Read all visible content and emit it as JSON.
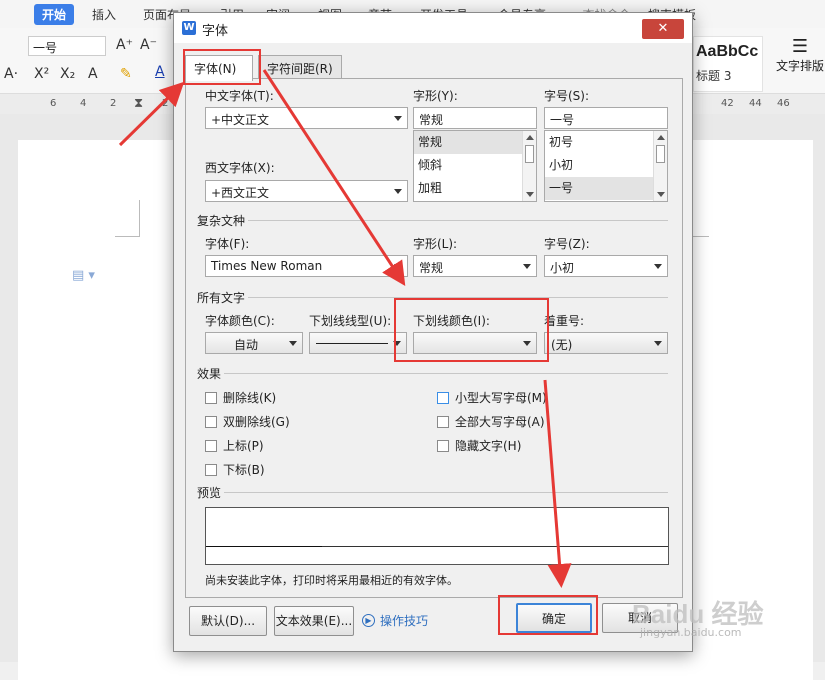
{
  "app": {
    "menu": [
      "开始",
      "插入",
      "页面布局",
      "引用",
      "审阅",
      "视图",
      "章节",
      "开发工具",
      "会员专享",
      "查找命令",
      "搜索模板"
    ],
    "font_size_combo": "一号",
    "style_preview": {
      "sample": "AaBbCc",
      "name": "标题 3"
    },
    "layout_button": "文字排版",
    "ruler": [
      "6",
      "4",
      "2",
      "2",
      "42",
      "44",
      "46"
    ]
  },
  "dialog": {
    "title": "字体",
    "close_glyph": "✕",
    "tabs": [
      "字体(N)",
      "字符间距(R)"
    ],
    "cn_font_label": "中文字体(T):",
    "cn_font_value": "+中文正文",
    "west_font_label": "西文字体(X):",
    "west_font_value": "+西文正文",
    "style_label": "字形(Y):",
    "style_value": "常规",
    "style_list": [
      "常规",
      "倾斜",
      "加粗"
    ],
    "size_label": "字号(S):",
    "size_value": "一号",
    "size_list": [
      "初号",
      "小初",
      "一号"
    ],
    "complex": {
      "title": "复杂文种",
      "font_label": "字体(F):",
      "font_value": "Times New Roman",
      "style_label": "字形(L):",
      "style_value": "常规",
      "size_label": "字号(Z):",
      "size_value": "小初"
    },
    "all_text": {
      "title": "所有文字",
      "color_label": "字体颜色(C):",
      "color_value": "自动",
      "underline_type_label": "下划线线型(U):",
      "underline_color_label": "下划线颜色(I):",
      "emphasis_label": "着重号:",
      "emphasis_value": "(无)"
    },
    "effects": {
      "title": "效果",
      "items": [
        "删除线(K)",
        "双删除线(G)",
        "上标(P)",
        "下标(B)",
        "小型大写字母(M)",
        "全部大写字母(A)",
        "隐藏文字(H)"
      ]
    },
    "preview": {
      "title": "预览",
      "note": "尚未安装此字体，打印时将采用最相近的有效字体。"
    },
    "buttons": {
      "default": "默认(D)...",
      "text_effect": "文本效果(E)...",
      "tips": "操作技巧",
      "ok": "确定",
      "cancel": "取消"
    }
  },
  "watermark": {
    "brand": "Baidu 经验",
    "url": "jingyan.baidu.com"
  },
  "colors": {
    "annotation_red": "#e53935",
    "accent_blue": "#3b7ee8"
  }
}
